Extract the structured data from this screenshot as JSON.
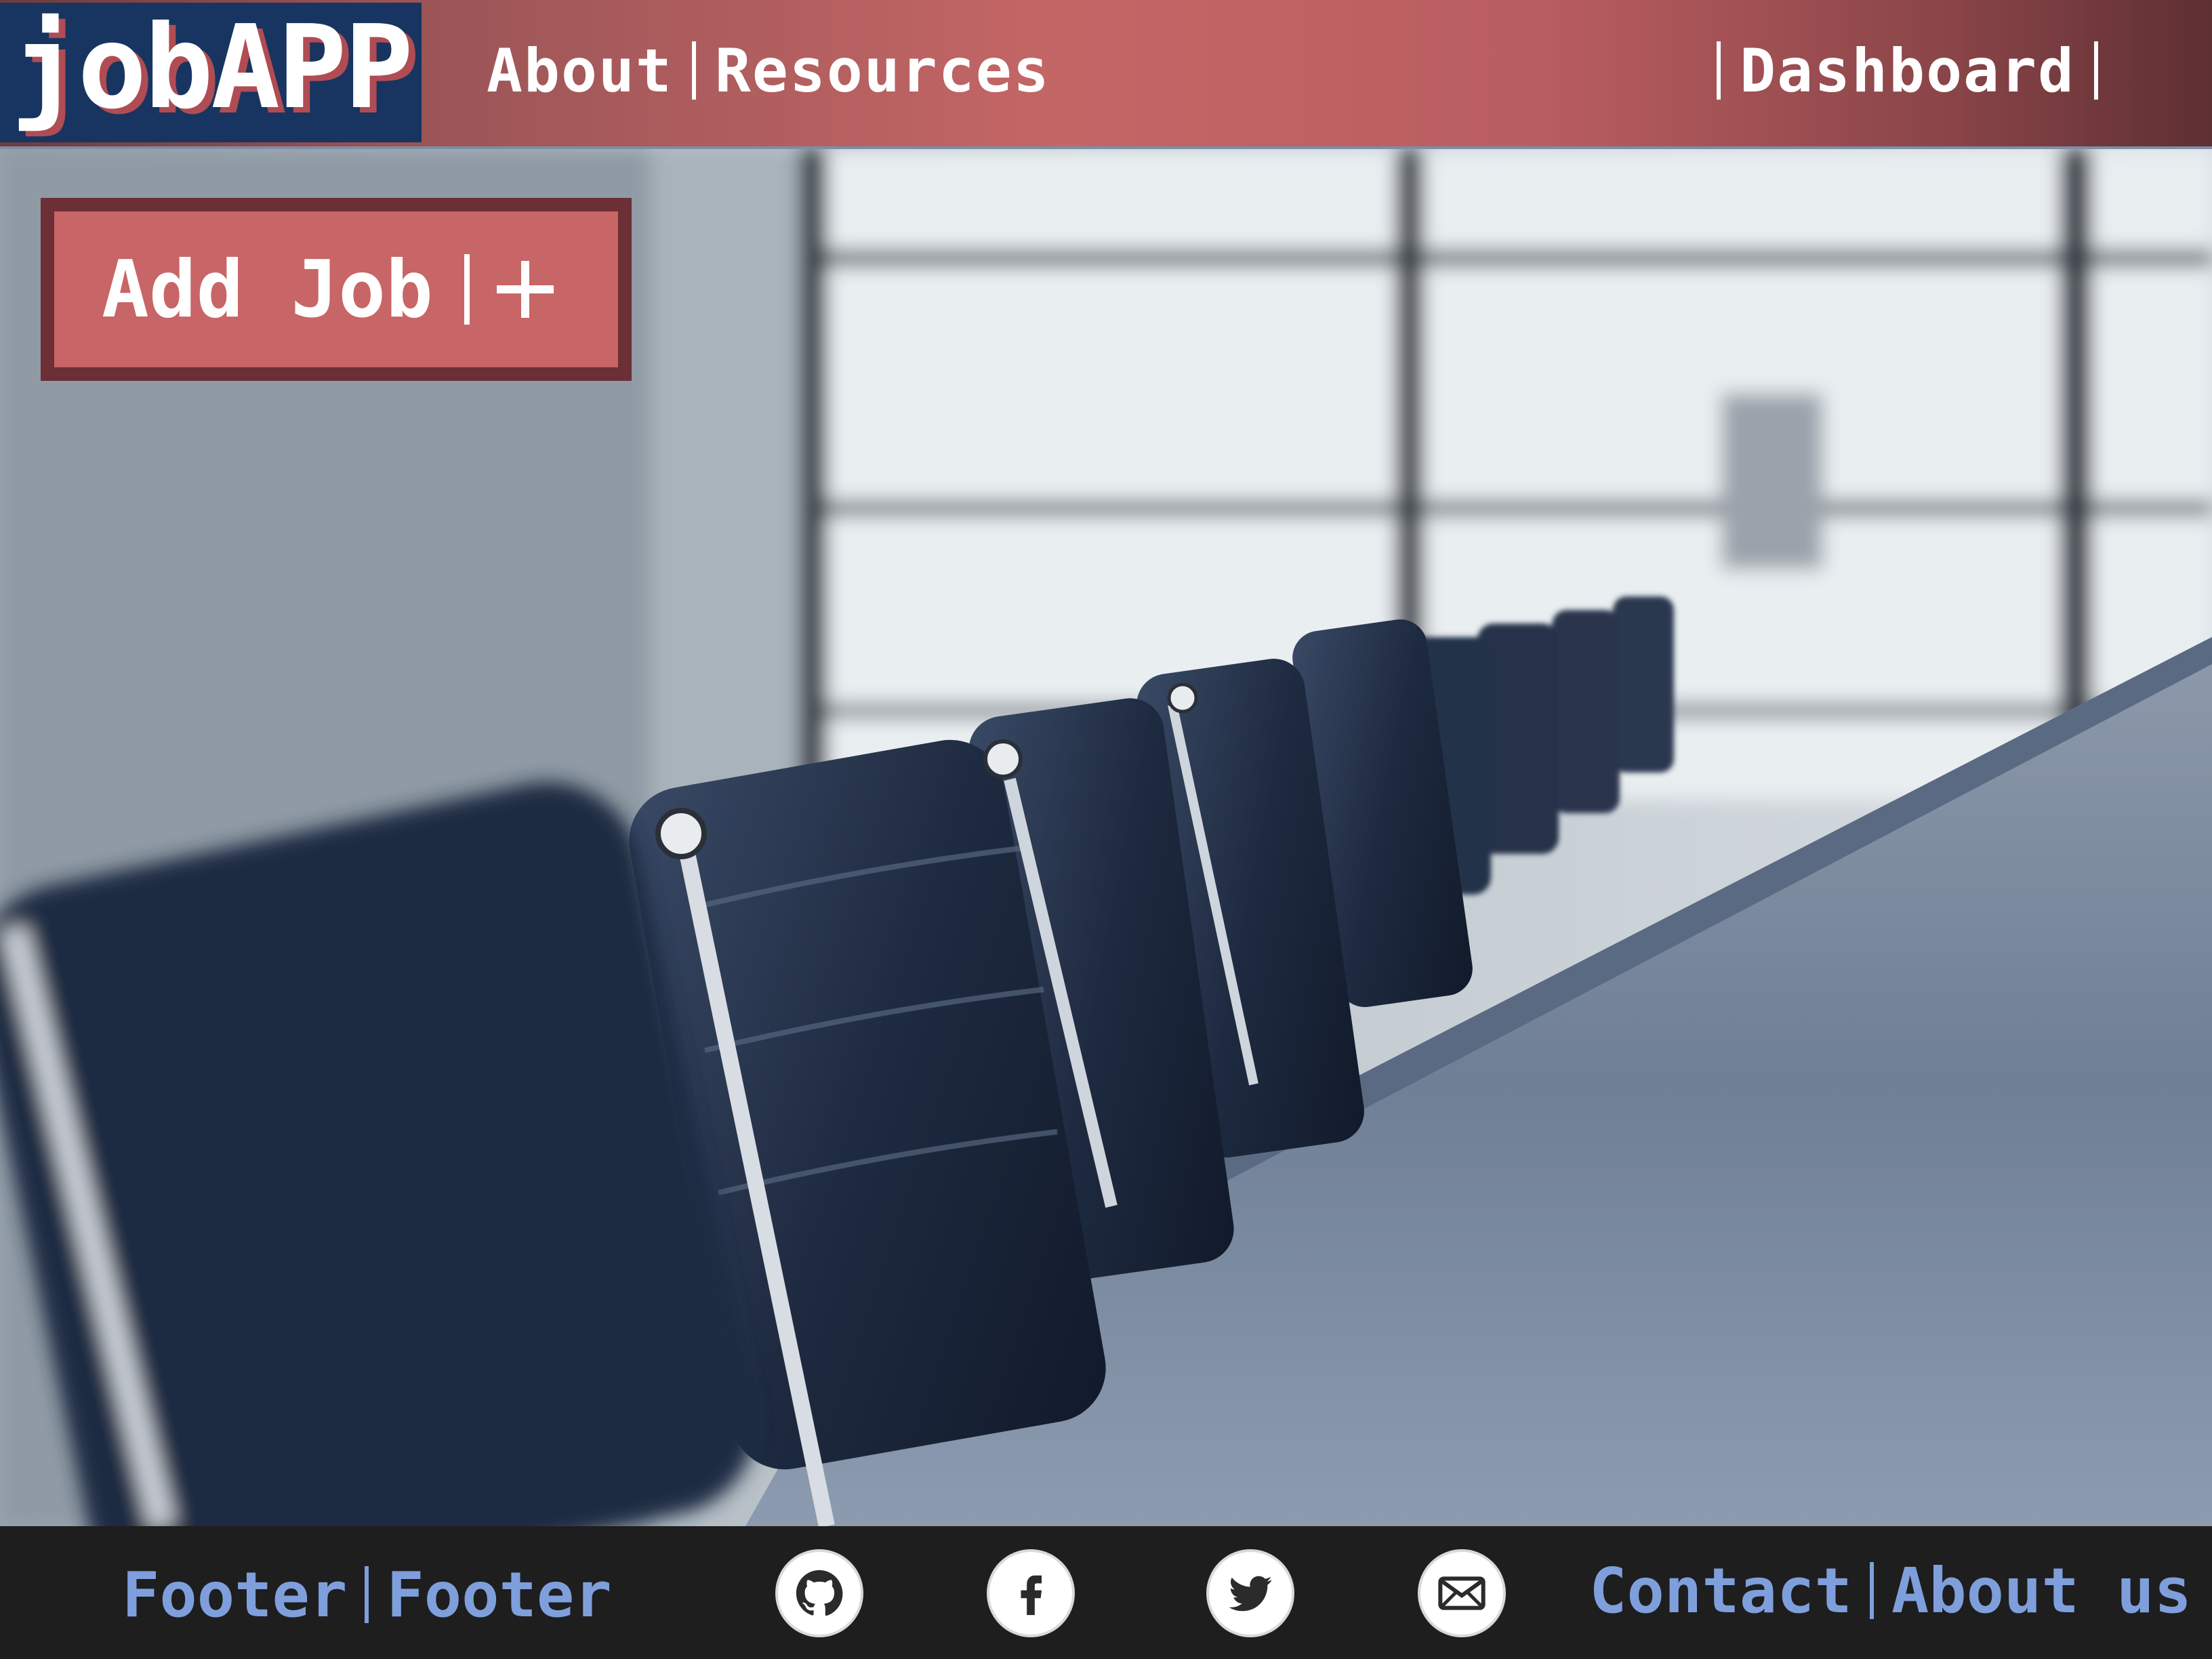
{
  "header": {
    "logo": "jobAPP",
    "nav_left": [
      {
        "label": "About"
      },
      {
        "label": "Resources"
      }
    ],
    "nav_right": {
      "label": "Dashboard"
    }
  },
  "main": {
    "add_job_label": "Add Job",
    "add_icon": "plus-icon",
    "background_image": "conference-room-chairs-photo"
  },
  "footer": {
    "left_links": [
      {
        "label": "Footer"
      },
      {
        "label": "Footer"
      }
    ],
    "social_icons": [
      "github-icon",
      "facebook-icon",
      "twitter-icon",
      "mail-icon"
    ],
    "right_links": [
      {
        "label": "Contact"
      },
      {
        "label": "About us"
      }
    ]
  },
  "colors": {
    "header_accent": "#c46666",
    "logo_bg": "#173560",
    "button_bg": "#c86566",
    "button_border": "#6b2f35",
    "footer_bg": "#1e1e1e",
    "footer_link": "#7f9fdc"
  }
}
